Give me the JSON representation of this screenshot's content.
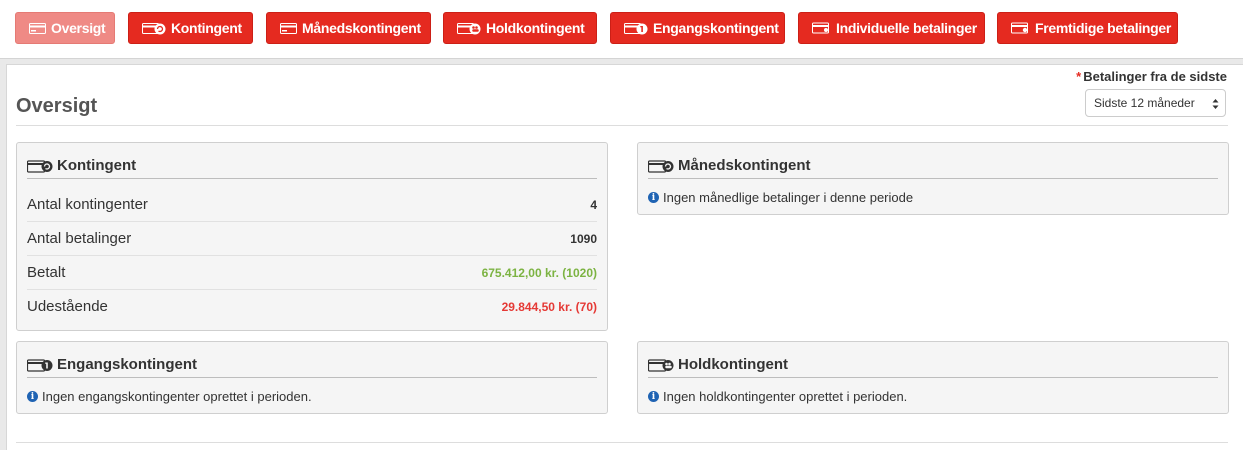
{
  "colors": {
    "brand_red": "#e52a20",
    "active_tab": "#ef8a85",
    "paid_green": "#7cb342",
    "outstanding_red": "#e53935",
    "info_blue": "#1f63b3"
  },
  "tabs": [
    {
      "label": "Oversigt",
      "icon": "card-icon",
      "active": true
    },
    {
      "label": "Kontingent",
      "icon": "card-refresh-icon",
      "active": false
    },
    {
      "label": "Månedskontingent",
      "icon": "card-icon",
      "active": false
    },
    {
      "label": "Holdkontingent",
      "icon": "card-team-icon",
      "active": false
    },
    {
      "label": "Engangskontingent",
      "icon": "card-one-icon",
      "active": false
    },
    {
      "label": "Individuelle betalinger",
      "icon": "card-person-icon",
      "active": false
    },
    {
      "label": "Fremtidige betalinger",
      "icon": "card-clock-icon",
      "active": false
    }
  ],
  "page": {
    "title": "Oversigt"
  },
  "period": {
    "required_marker": "*",
    "label": "Betalinger fra de sidste",
    "selected": "Sidste 12 måneder"
  },
  "panels": {
    "kontingent": {
      "title": "Kontingent",
      "icon": "card-refresh-icon",
      "rows": [
        {
          "label": "Antal kontingenter",
          "value": "4"
        },
        {
          "label": "Antal betalinger",
          "value": "1090"
        },
        {
          "label": "Betalt",
          "value": "675.412,00 kr. (1020)"
        },
        {
          "label": "Udestående",
          "value": "29.844,50 kr. (70)"
        }
      ]
    },
    "maanedskontingent": {
      "title": "Månedskontingent",
      "icon": "card-refresh-icon",
      "info": "Ingen månedlige betalinger i denne periode"
    },
    "engangskontingent": {
      "title": "Engangskontingent",
      "icon": "card-one-icon",
      "info": "Ingen engangskontingenter oprettet i perioden."
    },
    "holdkontingent": {
      "title": "Holdkontingent",
      "icon": "card-team-icon",
      "info": "Ingen holdkontingenter oprettet i perioden."
    }
  }
}
